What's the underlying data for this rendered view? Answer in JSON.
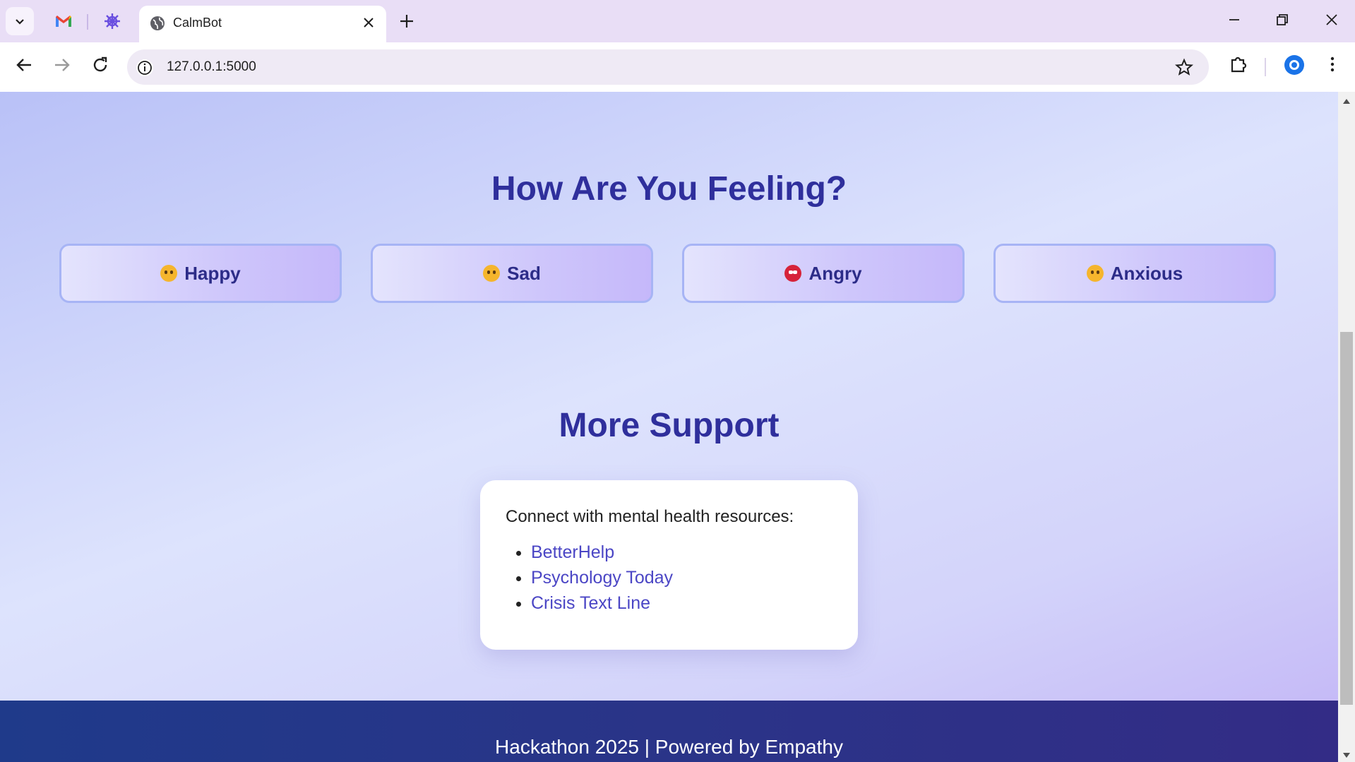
{
  "browser": {
    "tab_title": "CalmBot",
    "url": "127.0.0.1:5000",
    "pinned_tabs": [
      "gmail-icon",
      "perplexity-icon"
    ]
  },
  "mood_section": {
    "title": "How Are You Feeling?",
    "moods": [
      {
        "label": "Happy",
        "icon": "smiling-face-icon"
      },
      {
        "label": "Sad",
        "icon": "crying-face-icon"
      },
      {
        "label": "Angry",
        "icon": "angry-face-icon"
      },
      {
        "label": "Anxious",
        "icon": "worried-face-icon"
      }
    ]
  },
  "support_section": {
    "title": "More Support",
    "intro": "Connect with mental health resources:",
    "links": [
      "BetterHelp",
      "Psychology Today",
      "Crisis Text Line"
    ]
  },
  "footer": {
    "text": "Hackathon 2025 | Powered by Empathy"
  },
  "colors": {
    "heading": "#2f2f9c",
    "link": "#4b46c5",
    "footer_bg": "#2a3488"
  }
}
